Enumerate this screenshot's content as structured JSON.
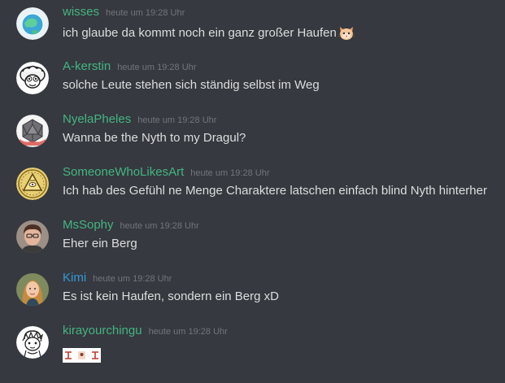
{
  "messages": [
    {
      "username": "wisses",
      "username_color": "#43b581",
      "timestamp": "heute um 19:28 Uhr",
      "text": "ich glaube da kommt noch ein ganz großer Haufen",
      "emoji": "cat-face-emoji"
    },
    {
      "username": "A-kerstin",
      "username_color": "#43b581",
      "timestamp": "heute um 19:28 Uhr",
      "text": "solche Leute stehen sich ständig selbst im Weg"
    },
    {
      "username": "NyelaPheles",
      "username_color": "#43b581",
      "timestamp": "heute um 19:28 Uhr",
      "text": "Wanna be the Nyth to my Dragul?"
    },
    {
      "username": "SomeoneWhoLikesArt",
      "username_color": "#43b581",
      "timestamp": "heute um 19:28 Uhr",
      "text": "Ich hab des Gefühl ne Menge Charaktere latschen einfach blind Nyth hinterher"
    },
    {
      "username": "MsSophy",
      "username_color": "#43b581",
      "timestamp": "heute um 19:28 Uhr",
      "text": "Eher ein Berg"
    },
    {
      "username": "Kimi",
      "username_color": "#3498db",
      "timestamp": "heute um 19:28 Uhr",
      "text": "Es ist kein Haufen, sondern ein Berg xD"
    },
    {
      "username": "kirayourchingu",
      "username_color": "#43b581",
      "timestamp": "heute um 19:28 Uhr",
      "text": "",
      "attachment": "image-attachment"
    }
  ]
}
